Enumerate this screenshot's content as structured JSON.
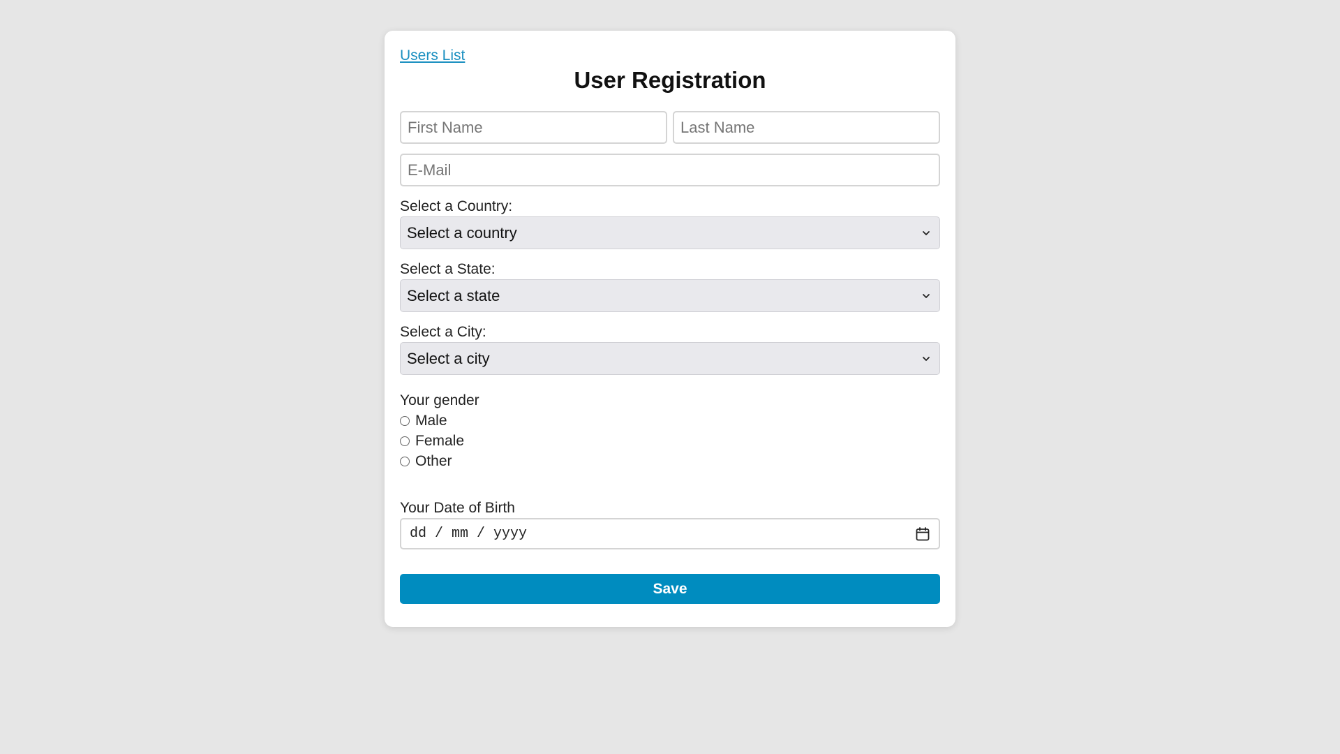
{
  "nav": {
    "users_list_link": "Users List"
  },
  "form": {
    "title": "User Registration",
    "first_name_placeholder": "First Name",
    "last_name_placeholder": "Last Name",
    "email_placeholder": "E-Mail",
    "country": {
      "label": "Select a Country:",
      "selected": "Select a country"
    },
    "state": {
      "label": "Select a State:",
      "selected": "Select a state"
    },
    "city": {
      "label": "Select a City:",
      "selected": "Select a city"
    },
    "gender": {
      "label": "Your gender",
      "options": [
        "Male",
        "Female",
        "Other"
      ]
    },
    "dob": {
      "label": "Your Date of Birth",
      "placeholder": "dd / mm / yyyy"
    },
    "save_label": "Save"
  },
  "colors": {
    "background": "#e6e6e6",
    "link": "#1a8fc0",
    "primary_button": "#008cbf",
    "select_bg": "#e9e9ed"
  },
  "icons": {
    "select_chevron": "chevron-down-icon",
    "date_picker": "calendar-icon"
  }
}
